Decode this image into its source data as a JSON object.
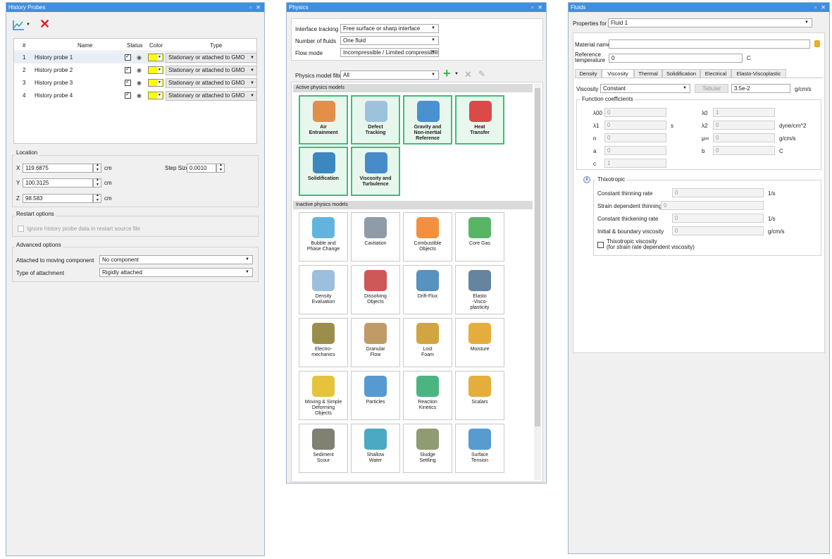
{
  "history": {
    "title": "History Probes",
    "controls": "▫ ✕",
    "columns": [
      "#",
      "Name",
      "Status",
      "Color",
      "Type"
    ],
    "rows": [
      {
        "num": "1",
        "name": "History probe 1",
        "type": "Stationary or attached to GMO"
      },
      {
        "num": "2",
        "name": "History probe 2",
        "type": "Stationary or attached to GMO"
      },
      {
        "num": "3",
        "name": "History probe 3",
        "type": "Stationary or attached to GMO"
      },
      {
        "num": "4",
        "name": "History probe 4",
        "type": "Stationary or attached to GMO"
      }
    ],
    "location_title": "Location",
    "x_label": "X",
    "x_value": "119.6875",
    "y_label": "Y",
    "y_value": "100.3125",
    "z_label": "Z",
    "z_value": "98.583",
    "unit": "cm",
    "step_label": "Step Size",
    "step_value": "0.0010",
    "restart_title": "Restart options",
    "restart_check": "Ignore history probe data in restart source file",
    "advanced_title": "Advanced options",
    "moving_label": "Attached to moving component",
    "moving_value": "No component",
    "attach_label": "Type of attachment",
    "attach_value": "Rigidly attached"
  },
  "physics": {
    "title": "Physics",
    "controls": "▫ ✕",
    "interface_label": "Interface tracking",
    "interface_value": "Free surface or sharp interface",
    "fluids_label": "Number of fluids",
    "fluids_value": "One fluid",
    "flow_label": "Flow mode",
    "flow_value": "Incompressible / Limited compressibility",
    "filter_label": "Physics model filter",
    "filter_value": "All",
    "active_title": "Active physics models",
    "inactive_title": "Inactive physics models",
    "active": [
      {
        "label": "Air\nEntrainment",
        "icon": "air-entrainment-icon"
      },
      {
        "label": "Defect\nTracking",
        "icon": "defect-tracking-icon"
      },
      {
        "label": "Gravity and\nNon-inertial\nReference",
        "icon": "gravity-icon"
      },
      {
        "label": "Heat\nTransfer",
        "icon": "heat-transfer-icon"
      },
      {
        "label": "Solidification",
        "icon": "solidification-icon"
      },
      {
        "label": "Viscosity and\nTurbulence",
        "icon": "viscosity-icon"
      }
    ],
    "inactive": [
      {
        "label": "Bubble and\nPhase Change",
        "icon": "bubble-icon"
      },
      {
        "label": "Cavitation",
        "icon": "cavitation-icon"
      },
      {
        "label": "Combustible\nObjects",
        "icon": "combustible-icon"
      },
      {
        "label": "Core Gas",
        "icon": "core-gas-icon"
      },
      {
        "label": "Density\nEvaluation",
        "icon": "density-icon"
      },
      {
        "label": "Dissolving\nObjects",
        "icon": "dissolving-icon"
      },
      {
        "label": "Drift-Flux",
        "icon": "drift-flux-icon"
      },
      {
        "label": "Elasto\n-Visco-\nplasticity",
        "icon": "elasto-icon"
      },
      {
        "label": "Electro-\nmechanics",
        "icon": "electro-icon"
      },
      {
        "label": "Granular\nFlow",
        "icon": "granular-icon"
      },
      {
        "label": "Lost\nFoam",
        "icon": "lost-foam-icon"
      },
      {
        "label": "Moisture",
        "icon": "moisture-icon"
      },
      {
        "label": "Moving & Simple\nDeforming\nObjects",
        "icon": "moving-objects-icon"
      },
      {
        "label": "Particles",
        "icon": "particles-icon"
      },
      {
        "label": "Reaction\nKinetics",
        "icon": "reaction-icon"
      },
      {
        "label": "Scalars",
        "icon": "scalars-icon"
      },
      {
        "label": "Sediment\nScour",
        "icon": "sediment-icon"
      },
      {
        "label": "Shallow\nWater",
        "icon": "shallow-water-icon"
      },
      {
        "label": "Sludge\nSettling",
        "icon": "sludge-icon"
      },
      {
        "label": "Surface\nTension",
        "icon": "surface-tension-icon"
      }
    ]
  },
  "fluids": {
    "title": "Fluids",
    "controls": "▫ ✕",
    "props_label": "Properties for",
    "props_value": "Fluid 1",
    "material_label": "Material name",
    "material_value": "",
    "reftemp_label": "Reference\ntemperature",
    "reftemp_value": "0",
    "reftemp_unit": "C",
    "tabs": [
      "Density",
      "Viscosity",
      "Thermal",
      "Solidification",
      "Electrical",
      "Elasto-Viscoplastic"
    ],
    "viscosity_label": "Viscosity",
    "viscosity_value": "Constant",
    "tabular_label": "Tabular",
    "visc_number": "3.5e-2",
    "visc_unit": "g/cm/s",
    "func_title": "Function coefficients",
    "coef": {
      "l00": "λ00",
      "l00v": "0",
      "l0": "λ0",
      "l0v": "1",
      "l1": "λ1",
      "l1v": "0",
      "l1u": "s",
      "l2": "λ2",
      "l2v": "0",
      "l2u": "dyne/cm^2",
      "n": "n",
      "nv": "0",
      "muinf": "μ∞",
      "muinfv": "0",
      "muinfu": "g/cm/s",
      "a": "a",
      "av": "0",
      "b": "b",
      "bv": "0",
      "bu": "C",
      "c": "c",
      "cv": "1"
    },
    "thixo_title": "Thixotropic",
    "thin_label": "Constant thinning rate",
    "thin_value": "0",
    "thin_unit": "1/s",
    "strain_label": "Strain dependent thinning rate",
    "strain_value": "0",
    "thick_label": "Constant thickening rate",
    "thick_value": "0",
    "thick_unit": "1/s",
    "init_label": "Initial & boundary viscosity",
    "init_value": "0",
    "init_unit": "g/cm/s",
    "thixo_check": "Thixotropic viscosity\n(for strain rate dependent viscosity)"
  }
}
